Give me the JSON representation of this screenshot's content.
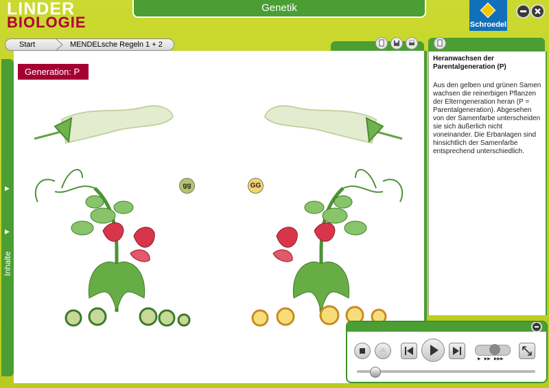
{
  "app": {
    "logo_line1": "LINDER",
    "logo_line2": "BIOLOGIE",
    "title": "Genetik",
    "publisher": "Schroedel"
  },
  "colors": {
    "frame_green": "#c6d62a",
    "dark_green": "#4b9e34",
    "badge_red": "#a50034",
    "publisher_blue": "#1170b9"
  },
  "breadcrumb": {
    "start": "Start",
    "current": "MENDELsche Regeln 1 + 2"
  },
  "sidebar": {
    "label": "Inhalte"
  },
  "main": {
    "generation_label": "Generation: P",
    "left_genotype": "gg",
    "right_genotype": "GG",
    "left_seed_color": "green",
    "right_seed_color": "yellow"
  },
  "info": {
    "title": "Heranwachsen der Parentalgeneration (P)",
    "body": "Aus den gelben und grünen Samen wachsen die reinerbigen Pflanzen der Elterngeneration heran (P = Parentalgeneration). Abgesehen von der Samenfarbe unterscheiden sie sich äußerlich nicht voneinander. Die Erbanlagen sind hinsichtlich der Samenfarbe entsprechend unterschiedlich."
  },
  "icons": {
    "minimize": "minimize-icon",
    "close": "close-icon",
    "copy": "copy-icon",
    "save": "save-icon",
    "print": "print-icon",
    "stop": "stop-icon",
    "eject": "eject-icon",
    "prev": "skip-back-icon",
    "play": "play-icon",
    "next": "skip-forward-icon",
    "fullscreen": "fullscreen-icon"
  },
  "player": {
    "progress": 0.1
  }
}
